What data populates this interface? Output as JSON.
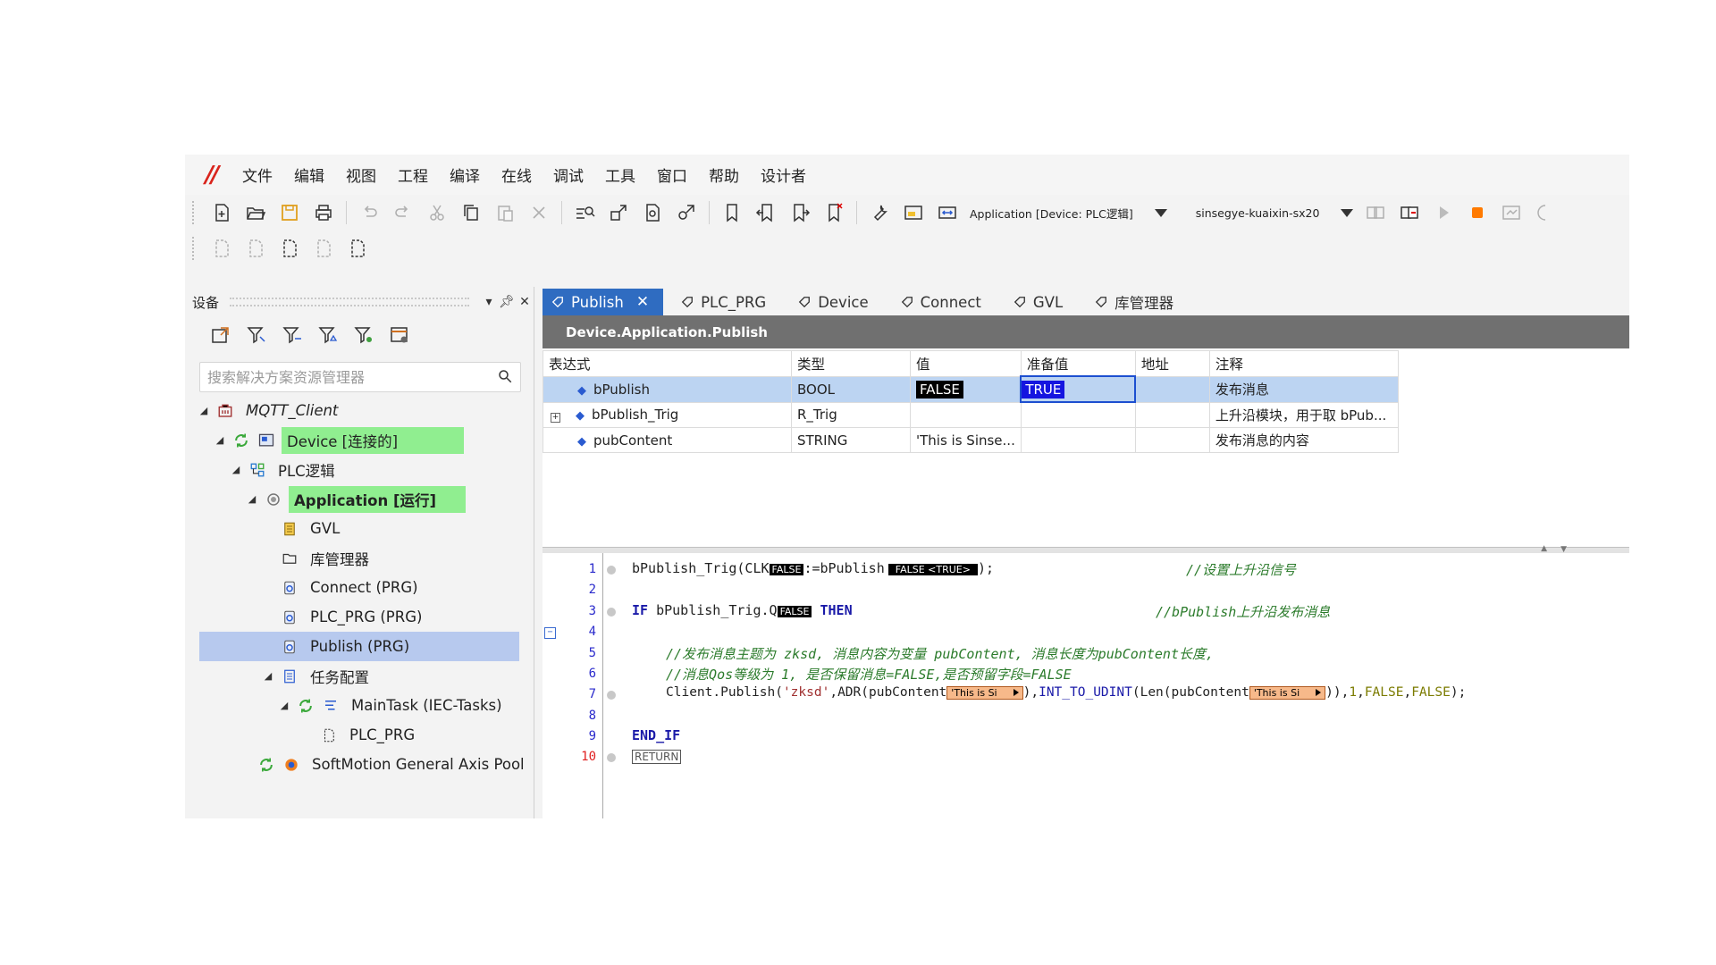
{
  "menu": {
    "items": [
      "文件",
      "编辑",
      "视图",
      "工程",
      "编译",
      "在线",
      "调试",
      "工具",
      "窗口",
      "帮助",
      "设计者"
    ]
  },
  "toolbar": {
    "application_combo": "Application [Device: PLC逻辑]",
    "gateway_combo": "sinsegye-kuaixin-sx20"
  },
  "devices_panel": {
    "title": "设备",
    "search_placeholder": "搜索解决方案资源管理器",
    "tree": {
      "root": "MQTT_Client",
      "device": "Device [连接的]",
      "plc_logic": "PLC逻辑",
      "application": "Application [运行]",
      "gvl": "GVL",
      "library_manager": "库管理器",
      "connect": "Connect (PRG)",
      "plc_prg": "PLC_PRG (PRG)",
      "publish": "Publish (PRG)",
      "task_config": "任务配置",
      "main_task": "MainTask (IEC-Tasks)",
      "main_task_plc_prg": "PLC_PRG",
      "softmotion": "SoftMotion General Axis Pool"
    },
    "highlight_color": "#90ee90",
    "selection_color": "#b7c9ee"
  },
  "editor": {
    "tabs": [
      {
        "label": "Publish",
        "active": true
      },
      {
        "label": "PLC_PRG"
      },
      {
        "label": "Device"
      },
      {
        "label": "Connect"
      },
      {
        "label": "GVL"
      },
      {
        "label": "库管理器"
      }
    ],
    "path": "Device.Application.Publish",
    "columns": [
      "表达式",
      "类型",
      "值",
      "准备值",
      "地址",
      "注释"
    ],
    "rows": [
      {
        "expr": "bPublish",
        "type": "BOOL",
        "value": "FALSE",
        "prepared": "TRUE",
        "address": "",
        "comment": "发布消息"
      },
      {
        "expr": "bPublish_Trig",
        "type": "R_Trig",
        "value": "",
        "prepared": "",
        "address": "",
        "comment": "上升沿模块，用于取 bPub..."
      },
      {
        "expr": "pubContent",
        "type": "STRING",
        "value": "'This is Sinse...",
        "prepared": "",
        "address": "",
        "comment": "发布消息的内容"
      }
    ],
    "code": {
      "line_numbers": [
        "1",
        "2",
        "3",
        "4",
        "5",
        "6",
        "7",
        "8",
        "9",
        "10"
      ],
      "l1_code": "bPublish_Trig(CLK",
      "l1_mon1": "FALSE",
      "l1_mid": ":=bPublish",
      "l1_mon2": "FALSE <TRUE>",
      "l1_end": ");",
      "l1_comment": "//设置上升沿信号",
      "l3_if": "IF",
      "l3_code": " bPublish_Trig.Q",
      "l3_mon": "FALSE",
      "l3_then": "THEN",
      "l3_comment": "//bPublish上升沿发布消息",
      "l5_comment": "//发布消息主题为 zksd, 消息内容为变量 pubContent, 消息长度为pubContent长度,",
      "l6_comment": "//消息Qos等级为 1, 是否保留消息=FALSE,是否预留字段=FALSE",
      "l7_a": "Client.Publish(",
      "l7_str": "'zksd'",
      "l7_b": ",ADR(pubContent",
      "l7_mon1": "'This is Si",
      "l7_c": "),",
      "l7_fn1": "INT_TO_UDINT",
      "l7_d": "(Len(pubContent",
      "l7_mon2": "'This is Si",
      "l7_e": ")),",
      "l7_num": "1",
      "l7_f": ",",
      "l7_bool1": "FALSE",
      "l7_g": ",",
      "l7_bool2": "FALSE",
      "l7_h": ");",
      "l9_endif": "END_IF",
      "l10_return": "RETURN"
    }
  }
}
